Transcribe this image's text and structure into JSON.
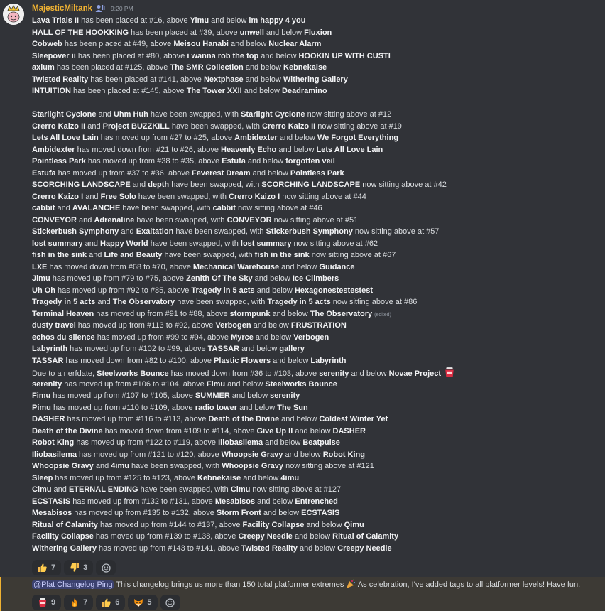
{
  "message": {
    "author": "MajesticMiltank",
    "timestamp": "9:20 PM",
    "edited_label": "(edited)",
    "lines": [
      [
        {
          "t": "Lava Trials II",
          "b": true
        },
        {
          "t": " has been placed at #16, above "
        },
        {
          "t": "Yimu",
          "b": true
        },
        {
          "t": " and below "
        },
        {
          "t": "im happy 4 you",
          "b": true
        }
      ],
      [
        {
          "t": "HALL OF THE HOOKKING",
          "b": true
        },
        {
          "t": " has been placed at #39, above "
        },
        {
          "t": "unwell",
          "b": true
        },
        {
          "t": " and below "
        },
        {
          "t": "Fluxion",
          "b": true
        }
      ],
      [
        {
          "t": "Cobweb",
          "b": true
        },
        {
          "t": " has been placed at #49, above "
        },
        {
          "t": "Meisou Hanabi",
          "b": true
        },
        {
          "t": " and below "
        },
        {
          "t": "Nuclear Alarm",
          "b": true
        }
      ],
      [
        {
          "t": "Sleepover ii",
          "b": true
        },
        {
          "t": " has been placed at #80, above "
        },
        {
          "t": "i wanna rob the top",
          "b": true
        },
        {
          "t": " and below "
        },
        {
          "t": "HOOKIN UP WITH CUSTI",
          "b": true
        }
      ],
      [
        {
          "t": "axium",
          "b": true
        },
        {
          "t": " has been placed at #125, above "
        },
        {
          "t": "The SMR Collection",
          "b": true
        },
        {
          "t": " and below "
        },
        {
          "t": "Kebnekaise",
          "b": true
        }
      ],
      [
        {
          "t": "Twisted Reality",
          "b": true
        },
        {
          "t": " has been placed at #141, above "
        },
        {
          "t": "Nextphase",
          "b": true
        },
        {
          "t": " and below "
        },
        {
          "t": "Withering Gallery",
          "b": true
        }
      ],
      [
        {
          "t": "INTUITION",
          "b": true
        },
        {
          "t": " has been placed at #145, above "
        },
        {
          "t": "The Tower XXII",
          "b": true
        },
        {
          "t": " and below "
        },
        {
          "t": "Deadramino",
          "b": true
        }
      ],
      [],
      [
        {
          "t": "Starlight Cyclone",
          "b": true
        },
        {
          "t": " and "
        },
        {
          "t": "Uhm Huh",
          "b": true
        },
        {
          "t": " have been swapped, with "
        },
        {
          "t": "Starlight Cyclone",
          "b": true
        },
        {
          "t": " now sitting above at #12"
        }
      ],
      [
        {
          "t": "Crerro Kaizo II",
          "b": true
        },
        {
          "t": " and "
        },
        {
          "t": "Project BUZZKILL",
          "b": true
        },
        {
          "t": " have been swapped, with "
        },
        {
          "t": "Crerro Kaizo II",
          "b": true
        },
        {
          "t": " now sitting above at #19"
        }
      ],
      [
        {
          "t": "Lets All Love Lain",
          "b": true
        },
        {
          "t": " has moved up from #27 to #25, above "
        },
        {
          "t": "Ambidexter",
          "b": true
        },
        {
          "t": " and below "
        },
        {
          "t": "We Forgot Everything",
          "b": true
        }
      ],
      [
        {
          "t": "Ambidexter",
          "b": true
        },
        {
          "t": " has moved down from #21 to #26, above "
        },
        {
          "t": "Heavenly Echo",
          "b": true
        },
        {
          "t": " and below "
        },
        {
          "t": "Lets All Love Lain",
          "b": true
        }
      ],
      [
        {
          "t": "Pointless Park",
          "b": true
        },
        {
          "t": " has moved up from #38 to #35, above "
        },
        {
          "t": "Estufa",
          "b": true
        },
        {
          "t": " and below "
        },
        {
          "t": "forgotten veil",
          "b": true
        }
      ],
      [
        {
          "t": "Estufa",
          "b": true
        },
        {
          "t": " has moved up from #37 to #36, above "
        },
        {
          "t": "Feverest Dream",
          "b": true
        },
        {
          "t": " and below "
        },
        {
          "t": "Pointless Park",
          "b": true
        }
      ],
      [
        {
          "t": "SCORCHING LANDSCAPE",
          "b": true
        },
        {
          "t": " and "
        },
        {
          "t": "depth",
          "b": true
        },
        {
          "t": " have been swapped, with "
        },
        {
          "t": "SCORCHING LANDSCAPE",
          "b": true
        },
        {
          "t": " now sitting above at #42"
        }
      ],
      [
        {
          "t": "Crerro Kaizo I",
          "b": true
        },
        {
          "t": " and "
        },
        {
          "t": "Free Solo",
          "b": true
        },
        {
          "t": " have been swapped, with "
        },
        {
          "t": "Crerro Kaizo I",
          "b": true
        },
        {
          "t": " now sitting above at #44"
        }
      ],
      [
        {
          "t": "cabbit",
          "b": true
        },
        {
          "t": " and "
        },
        {
          "t": "AVALANCHE",
          "b": true
        },
        {
          "t": " have been swapped, with "
        },
        {
          "t": "cabbit",
          "b": true
        },
        {
          "t": " now sitting above at #46"
        }
      ],
      [
        {
          "t": "CONVEYOR",
          "b": true
        },
        {
          "t": " and "
        },
        {
          "t": "Adrenaline",
          "b": true
        },
        {
          "t": " have been swapped, with "
        },
        {
          "t": "CONVEYOR",
          "b": true
        },
        {
          "t": " now sitting above at #51"
        }
      ],
      [
        {
          "t": "Stickerbush Symphony",
          "b": true
        },
        {
          "t": " and "
        },
        {
          "t": "Exaltation",
          "b": true
        },
        {
          "t": " have been swapped, with "
        },
        {
          "t": "Stickerbush Symphony",
          "b": true
        },
        {
          "t": " now sitting above at #57"
        }
      ],
      [
        {
          "t": "lost summary",
          "b": true
        },
        {
          "t": " and "
        },
        {
          "t": "Happy World",
          "b": true
        },
        {
          "t": " have been swapped, with "
        },
        {
          "t": "lost summary",
          "b": true
        },
        {
          "t": " now sitting above at #62"
        }
      ],
      [
        {
          "t": "fish in the sink",
          "b": true
        },
        {
          "t": " and "
        },
        {
          "t": "Life and Beauty",
          "b": true
        },
        {
          "t": " have been swapped, with "
        },
        {
          "t": "fish in the sink",
          "b": true
        },
        {
          "t": " now sitting above at #67"
        }
      ],
      [
        {
          "t": "LXE",
          "b": true
        },
        {
          "t": " has moved down from #68 to #70, above "
        },
        {
          "t": "Mechanical Warehouse",
          "b": true
        },
        {
          "t": " and below "
        },
        {
          "t": "Guidance",
          "b": true
        }
      ],
      [
        {
          "t": "Jimu",
          "b": true
        },
        {
          "t": " has moved up from #79 to #75, above "
        },
        {
          "t": "Zenith Of The Sky",
          "b": true
        },
        {
          "t": " and below "
        },
        {
          "t": "Ice Climbers",
          "b": true
        }
      ],
      [
        {
          "t": "Uh Oh",
          "b": true
        },
        {
          "t": " has moved up from #92 to #85, above "
        },
        {
          "t": "Tragedy in 5 acts",
          "b": true
        },
        {
          "t": " and below "
        },
        {
          "t": "Hexagonestestestest",
          "b": true
        }
      ],
      [
        {
          "t": "Tragedy in 5 acts",
          "b": true
        },
        {
          "t": " and "
        },
        {
          "t": "The Observatory",
          "b": true
        },
        {
          "t": " have been swapped, with "
        },
        {
          "t": "Tragedy in 5 acts",
          "b": true
        },
        {
          "t": " now sitting above at #86"
        }
      ],
      [
        {
          "t": "Terminal Heaven",
          "b": true
        },
        {
          "t": " has moved up from #91 to #88, above "
        },
        {
          "t": "stormpunk",
          "b": true
        },
        {
          "t": " and below "
        },
        {
          "t": "The Observatory",
          "b": true
        },
        {
          "edited": true
        }
      ],
      [
        {
          "t": "dusty travel",
          "b": true
        },
        {
          "t": " has moved up from #113 to #92, above "
        },
        {
          "t": "Verbogen",
          "b": true
        },
        {
          "t": " and below "
        },
        {
          "t": "FRUSTRATION",
          "b": true
        }
      ],
      [
        {
          "t": "echos du silence",
          "b": true
        },
        {
          "t": " has moved up from #99 to #94, above "
        },
        {
          "t": "Myrce",
          "b": true
        },
        {
          "t": " and below "
        },
        {
          "t": "Verbogen",
          "b": true
        }
      ],
      [
        {
          "t": "Labyrinth",
          "b": true
        },
        {
          "t": " has moved up from #102 to #99, above "
        },
        {
          "t": "TASSAR",
          "b": true
        },
        {
          "t": " and below "
        },
        {
          "t": "gallery",
          "b": true
        }
      ],
      [
        {
          "t": "TASSAR",
          "b": true
        },
        {
          "t": " has moved down from #82 to #100, above "
        },
        {
          "t": "Plastic Flowers",
          "b": true
        },
        {
          "t": " and below "
        },
        {
          "t": "Labyrinth",
          "b": true
        }
      ],
      [
        {
          "t": "Due to a nerfdate, "
        },
        {
          "t": "Steelworks Bounce",
          "b": true
        },
        {
          "t": " has moved down from #36 to #103, above "
        },
        {
          "t": "serenity",
          "b": true
        },
        {
          "t": " and below "
        },
        {
          "t": "Novae Project",
          "b": true
        },
        {
          "emoji": "jar"
        }
      ],
      [
        {
          "t": "serenity",
          "b": true
        },
        {
          "t": " has moved up from #106 to #104, above "
        },
        {
          "t": "Fimu",
          "b": true
        },
        {
          "t": " and below "
        },
        {
          "t": "Steelworks Bounce",
          "b": true
        }
      ],
      [
        {
          "t": "Fimu",
          "b": true
        },
        {
          "t": " has moved up from #107 to #105, above "
        },
        {
          "t": "SUMMER",
          "b": true
        },
        {
          "t": " and below "
        },
        {
          "t": "serenity",
          "b": true
        }
      ],
      [
        {
          "t": "Pimu",
          "b": true
        },
        {
          "t": " has moved up from #110 to #109, above "
        },
        {
          "t": "radio tower",
          "b": true
        },
        {
          "t": " and below "
        },
        {
          "t": "The Sun",
          "b": true
        }
      ],
      [
        {
          "t": "DASHER",
          "b": true
        },
        {
          "t": " has moved up from #116 to #113, above "
        },
        {
          "t": "Death of the Divine",
          "b": true
        },
        {
          "t": " and below "
        },
        {
          "t": "Coldest Winter Yet",
          "b": true
        }
      ],
      [
        {
          "t": "Death of the Divine",
          "b": true
        },
        {
          "t": " has moved down from #109 to #114, above "
        },
        {
          "t": "Give Up II",
          "b": true
        },
        {
          "t": " and below "
        },
        {
          "t": "DASHER",
          "b": true
        }
      ],
      [
        {
          "t": "Robot King",
          "b": true
        },
        {
          "t": " has moved up from #122 to #119, above "
        },
        {
          "t": "Iliobasilema",
          "b": true
        },
        {
          "t": " and below "
        },
        {
          "t": "Beatpulse",
          "b": true
        }
      ],
      [
        {
          "t": "Iliobasilema",
          "b": true
        },
        {
          "t": " has moved up from #121 to #120, above "
        },
        {
          "t": "Whoopsie Gravy",
          "b": true
        },
        {
          "t": " and below "
        },
        {
          "t": "Robot King",
          "b": true
        }
      ],
      [
        {
          "t": "Whoopsie Gravy",
          "b": true
        },
        {
          "t": " and "
        },
        {
          "t": "4imu",
          "b": true
        },
        {
          "t": " have been swapped, with "
        },
        {
          "t": "Whoopsie Gravy",
          "b": true
        },
        {
          "t": " now sitting above at #121"
        }
      ],
      [
        {
          "t": "Sleep",
          "b": true
        },
        {
          "t": " has moved up from #125 to #123, above "
        },
        {
          "t": "Kebnekaise",
          "b": true
        },
        {
          "t": " and below "
        },
        {
          "t": "4imu",
          "b": true
        }
      ],
      [
        {
          "t": "Cimu",
          "b": true
        },
        {
          "t": " and "
        },
        {
          "t": "ETERNAL ENDING",
          "b": true
        },
        {
          "t": " have been swapped, with "
        },
        {
          "t": "Cimu",
          "b": true
        },
        {
          "t": " now sitting above at #127"
        }
      ],
      [
        {
          "t": "ECSTASIS",
          "b": true
        },
        {
          "t": " has moved up from #132 to #131, above "
        },
        {
          "t": "Mesabisos",
          "b": true
        },
        {
          "t": " and below "
        },
        {
          "t": "Entrenched",
          "b": true
        }
      ],
      [
        {
          "t": "Mesabisos",
          "b": true
        },
        {
          "t": " has moved up from #135 to #132, above "
        },
        {
          "t": "Storm Front",
          "b": true
        },
        {
          "t": " and below "
        },
        {
          "t": "ECSTASIS",
          "b": true
        }
      ],
      [
        {
          "t": "Ritual of Calamity",
          "b": true
        },
        {
          "t": " has moved up from #144 to #137, above "
        },
        {
          "t": "Facility Collapse",
          "b": true
        },
        {
          "t": " and below "
        },
        {
          "t": "Qimu",
          "b": true
        }
      ],
      [
        {
          "t": "Facility Collapse",
          "b": true
        },
        {
          "t": " has moved up from #139 to #138, above "
        },
        {
          "t": "Creepy Needle",
          "b": true
        },
        {
          "t": " and below "
        },
        {
          "t": "Ritual of Calamity",
          "b": true
        }
      ],
      [
        {
          "t": "Withering Gallery",
          "b": true
        },
        {
          "t": " has moved up from #143 to #141, above "
        },
        {
          "t": "Twisted Reality",
          "b": true
        },
        {
          "t": " and below "
        },
        {
          "t": "Creepy Needle",
          "b": true
        }
      ]
    ],
    "reactions": [
      {
        "icon": "thumbs-up-icon",
        "count": "7"
      },
      {
        "icon": "thumbs-down-icon",
        "count": "3"
      }
    ]
  },
  "message2": {
    "mention": "@Plat Changelog Ping",
    "text_before_emoji": " This changelog brings us more than 150 total platformer extremes ",
    "text_after_emoji": " As celebration, I've added tags to all platformer levels! Have fun.",
    "reactions": [
      {
        "icon": "jar-icon",
        "count": "9"
      },
      {
        "icon": "fire-icon",
        "count": "7"
      },
      {
        "icon": "thumbs-up-icon",
        "count": "6"
      },
      {
        "icon": "fox-icon",
        "count": "5"
      }
    ]
  },
  "colors": {
    "background": "#313338",
    "author": "#f0b232",
    "highlight": "#3d3a35",
    "mention_bg": "#3c4270"
  }
}
